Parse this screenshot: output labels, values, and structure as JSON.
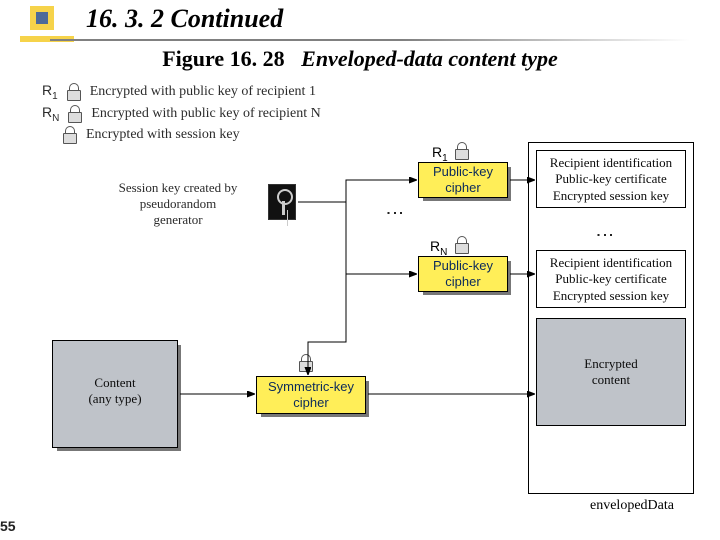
{
  "header": {
    "section": "16. 3. 2  Continued",
    "figure_label": "Figure 16. 28",
    "figure_caption": "Enveloped-data content type"
  },
  "legend": {
    "r1_tag": "R",
    "r1_sub": "1",
    "r1_text": "Encrypted with public key of recipient 1",
    "rn_tag": "R",
    "rn_sub": "N",
    "rn_text": "Encrypted with public key of recipient N",
    "sk_text": "Encrypted with session key",
    "keygen_l1": "Session key created by",
    "keygen_l2": "pseudorandom",
    "keygen_l3": "generator"
  },
  "labels": {
    "r1": "R",
    "r1_sub": "1",
    "rn": "R",
    "rn_sub": "N"
  },
  "boxes": {
    "pk_cipher": "Public-key\ncipher",
    "sym_cipher": "Symmetric-key\ncipher",
    "content_l1": "Content",
    "content_l2": "(any type)",
    "recip_l1": "Recipient identification",
    "recip_l2": "Public-key certificate",
    "recip_l3": "Encrypted session key",
    "enc_content": "Encrypted\ncontent"
  },
  "footer": {
    "envelope_caption": "envelopedData",
    "page": "55"
  }
}
